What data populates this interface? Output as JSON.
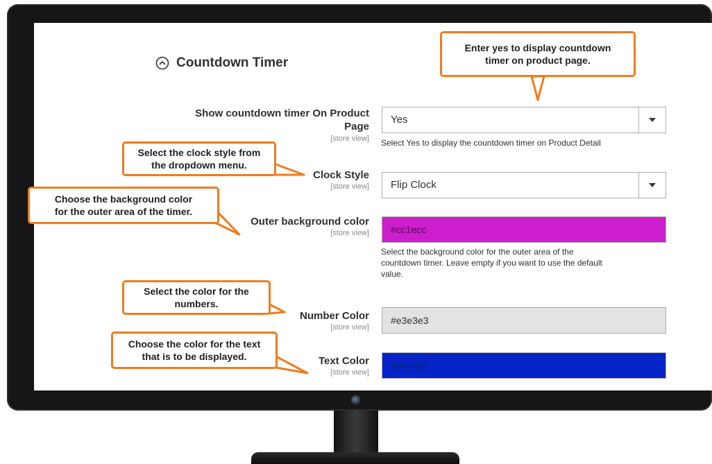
{
  "section": {
    "title": "Countdown Timer",
    "collapse_icon": "circle-chevron-up-icon"
  },
  "fields": {
    "show_timer": {
      "label_line1": "Show countdown timer On Product",
      "label_line2": "Page",
      "scope": "[store view]",
      "value": "Yes",
      "note": "Select Yes to display the countdown timer on Product Detail"
    },
    "clock_style": {
      "label": "Clock Style",
      "scope": "[store view]",
      "value": "Flip Clock"
    },
    "outer_bg": {
      "label": "Outer background color",
      "scope": "[store view]",
      "value": "#cc1ecc",
      "swatch": "#cc1ecc",
      "note_lines": [
        "Select the background color for the outer area of the",
        "countdown timer. Leave empty if you want to use the default",
        "value."
      ]
    },
    "number_color": {
      "label": "Number Color",
      "scope": "[store view]",
      "value": "#e3e3e3",
      "swatch": "#e3e3e3"
    },
    "text_color": {
      "label": "Text Color",
      "scope": "[store view]",
      "value": "#0424c7",
      "swatch": "#0424c7"
    }
  },
  "callouts": {
    "show_timer": {
      "line1": "Enter yes to display countdown",
      "line2": "timer on product page."
    },
    "clock_style": {
      "line1": "Select the clock style from",
      "line2": "the dropdown menu."
    },
    "outer_bg": {
      "line1": "Choose the background color",
      "line2": "for the outer area of the timer."
    },
    "number_color": {
      "line1": "Select the color for the",
      "line2": "numbers."
    },
    "text_color": {
      "line1": "Choose the color for the text",
      "line2": "that is to be displayed."
    }
  },
  "colors": {
    "callout_border": "#f07b1e",
    "bezel": "#161616"
  }
}
